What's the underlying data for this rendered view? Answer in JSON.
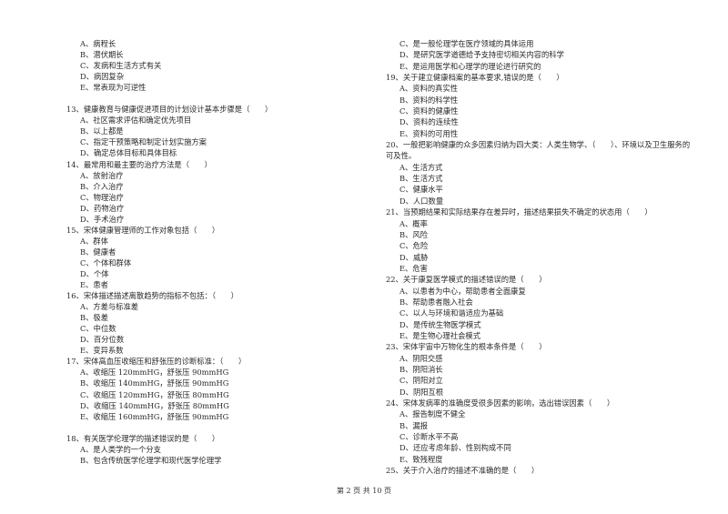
{
  "left_column": [
    {
      "t": "opt",
      "text": "A、病程长"
    },
    {
      "t": "opt",
      "text": "B、潜伏期长"
    },
    {
      "t": "opt",
      "text": "C、发病和生活方式有关"
    },
    {
      "t": "opt",
      "text": "D、病因复杂"
    },
    {
      "t": "opt",
      "text": "E、常表现为可逆性"
    },
    {
      "t": "blank",
      "text": ""
    },
    {
      "t": "q",
      "text": "13、健康教育与健康促进项目的计划设计基本步骤是（　　）"
    },
    {
      "t": "opt",
      "text": "A、社区需求评估和确定优先项目"
    },
    {
      "t": "opt",
      "text": "B、以上都是"
    },
    {
      "t": "opt",
      "text": "C、指定干预策略和制定计划实施方案"
    },
    {
      "t": "opt",
      "text": "D、确定总体目标和具体目标"
    },
    {
      "t": "q",
      "text": "14、最常用和最主要的治疗方法是（　　）"
    },
    {
      "t": "opt",
      "text": "A、放射治疗"
    },
    {
      "t": "opt",
      "text": "B、介入治疗"
    },
    {
      "t": "opt",
      "text": "C、物理治疗"
    },
    {
      "t": "opt",
      "text": "D、药物治疗"
    },
    {
      "t": "opt",
      "text": "D、手术治疗"
    },
    {
      "t": "q",
      "text": "15、宋体健康管理师的工作对象包括（　　）"
    },
    {
      "t": "opt",
      "text": "A、群体"
    },
    {
      "t": "opt",
      "text": "B、健康者"
    },
    {
      "t": "opt",
      "text": "C、个体和群体"
    },
    {
      "t": "opt",
      "text": "D、个体"
    },
    {
      "t": "opt",
      "text": "E、患者"
    },
    {
      "t": "q",
      "text": "16、宋体描述描述离散趋势的指标不包括：（　　）"
    },
    {
      "t": "opt",
      "text": "A、方差与标准差"
    },
    {
      "t": "opt",
      "text": "B、极差"
    },
    {
      "t": "opt",
      "text": "C、中位数"
    },
    {
      "t": "opt",
      "text": "D、百分位数"
    },
    {
      "t": "opt",
      "text": "E、变异系数"
    },
    {
      "t": "q",
      "text": "17、宋体高血压收缩压和舒张压的诊断标准：（　　）"
    },
    {
      "t": "opt",
      "text": "A、收缩压 120mmHG，舒张压 90mmHG"
    },
    {
      "t": "opt",
      "text": "B、收缩压 140mmHG，舒张压 90mmHG"
    },
    {
      "t": "opt",
      "text": "C、收缩压 120mmHG，舒张压 80mmHG"
    },
    {
      "t": "opt",
      "text": "D、收缩压 140mmHG，舒张压 80mmHG"
    },
    {
      "t": "opt",
      "text": "E、收缩压 160mmHG，舒张压 90mmHG"
    },
    {
      "t": "blank",
      "text": ""
    },
    {
      "t": "q",
      "text": "18、有关医学伦理学的描述错误的是（　　）"
    },
    {
      "t": "opt",
      "text": "A、是人类学的一个分支"
    },
    {
      "t": "opt",
      "text": "B、包含传统医学伦理学和现代医学伦理学"
    }
  ],
  "right_column": [
    {
      "t": "opt",
      "text": "C、是一般伦理学在医疗领域的具体运用"
    },
    {
      "t": "opt",
      "text": "D、是研究医学道德给予支持密切相关内容的科学"
    },
    {
      "t": "opt",
      "text": "E、是运用医学和心理学的理论进行研究的"
    },
    {
      "t": "q",
      "text": "19、关于建立健康档案的基本要求,错误的是（　　）"
    },
    {
      "t": "opt",
      "text": "A、资料的真实性"
    },
    {
      "t": "opt",
      "text": "B、资料的科学性"
    },
    {
      "t": "opt",
      "text": "C、资料的健康性"
    },
    {
      "t": "opt",
      "text": "D、资料的连续性"
    },
    {
      "t": "opt",
      "text": "E、资料的可用性"
    },
    {
      "t": "q",
      "text": "20、一般把影响健康的众多因素归纳为四大类：人类生物学、（　　）、环境以及卫生服务的"
    },
    {
      "t": "cont",
      "text": "可及性。"
    },
    {
      "t": "opt",
      "text": "A、生活方式"
    },
    {
      "t": "opt",
      "text": "B、生活方式"
    },
    {
      "t": "opt",
      "text": "C、健康水平"
    },
    {
      "t": "opt",
      "text": "D、人口数量"
    },
    {
      "t": "q",
      "text": "21、当预期结果和实际结果存在差异时，描述结果损失不确定的状态用（　　）"
    },
    {
      "t": "opt",
      "text": "A、概率"
    },
    {
      "t": "opt",
      "text": "B、风险"
    },
    {
      "t": "opt",
      "text": "C、危险"
    },
    {
      "t": "opt",
      "text": "D、威胁"
    },
    {
      "t": "opt",
      "text": "E、危害"
    },
    {
      "t": "q",
      "text": "22、关于康复医学模式的描述错误的是（　　）"
    },
    {
      "t": "opt",
      "text": "A、以患者为中心，帮助患者全面康复"
    },
    {
      "t": "opt",
      "text": "B、帮助患者融入社会"
    },
    {
      "t": "opt",
      "text": "C、以人与环境和谐适应为基础"
    },
    {
      "t": "opt",
      "text": "D、是传统生物医学模式"
    },
    {
      "t": "opt",
      "text": "E、是生物心理社会模式"
    },
    {
      "t": "q",
      "text": "23、宋体宇宙中万物化生的根本条件是（　　）"
    },
    {
      "t": "opt",
      "text": "A、阴阳交感"
    },
    {
      "t": "opt",
      "text": "B、阴阳消长"
    },
    {
      "t": "opt",
      "text": "C、阴阳对立"
    },
    {
      "t": "opt",
      "text": "D、阴阳互根"
    },
    {
      "t": "q",
      "text": "24、宋体发病率的准确度受很多因素的影响，选出错误因素（　　）"
    },
    {
      "t": "opt",
      "text": "A、报告制度不健全"
    },
    {
      "t": "opt",
      "text": "B、漏报"
    },
    {
      "t": "opt",
      "text": "C、诊断水平不高"
    },
    {
      "t": "opt",
      "text": "D、还应考虑年龄、性别构成不同"
    },
    {
      "t": "opt",
      "text": "E、致残程度"
    },
    {
      "t": "q",
      "text": "25、关于介入治疗的描述不准确的是（　　）"
    }
  ],
  "footer": {
    "page_label": "第 2 页 共 10 页"
  }
}
